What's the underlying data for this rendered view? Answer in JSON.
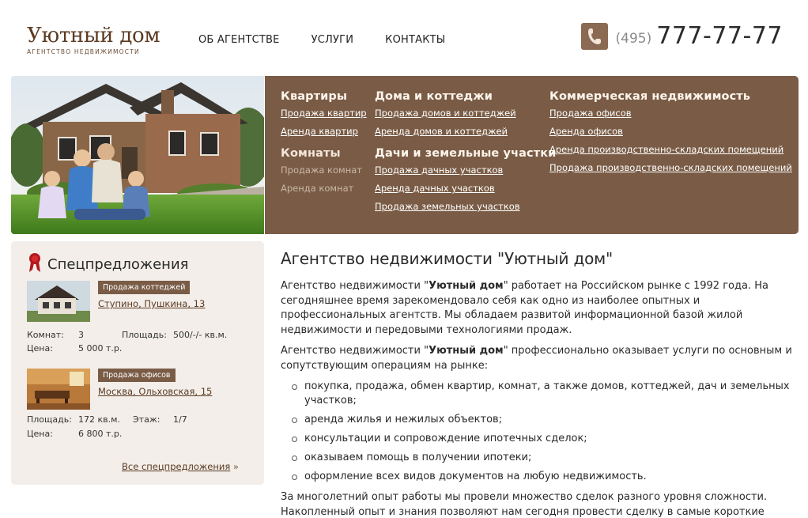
{
  "header": {
    "logo_title": "Уютный дом",
    "logo_subtitle": "АГЕНТСТВО НЕДВИЖИМОСТИ",
    "nav": [
      "ОБ АГЕНТСТВЕ",
      "УСЛУГИ",
      "КОНТАКТЫ"
    ],
    "phone_code": "(495)",
    "phone_number": "777-77-77",
    "phone_icon": "phone-icon"
  },
  "menu": {
    "col1": {
      "heading1": "Квартиры",
      "links1": [
        "Продажа квартир",
        "Аренда квартир"
      ],
      "heading2": "Комнаты",
      "links2": [
        "Продажа комнат",
        "Аренда комнат"
      ]
    },
    "col2": {
      "heading1": "Дома и коттеджи",
      "links1": [
        "Продажа домов и коттеджей",
        "Аренда домов и коттеджей"
      ],
      "heading2": "Дачи и земельные участки",
      "links2": [
        "Продажа дачных участков",
        "Аренда дачных участков",
        "Продажа земельных участков"
      ]
    },
    "col3": {
      "heading1": "Коммерческая недвижимость",
      "links1": [
        "Продажа офисов",
        "Аренда офисов",
        "Аренда производственно-складских помещений",
        "Продажа производственно-складских помещений"
      ]
    }
  },
  "sidebar": {
    "title": "Спецпредложения",
    "offers": [
      {
        "tag": "Продажа коттеджей",
        "address": "Ступино, Пушкина, 13",
        "rooms_label": "Комнат:",
        "rooms_value": "3",
        "area_label": "Площадь:",
        "area_value": "500/-/- кв.м.",
        "price_label": "Цена:",
        "price_value": "5 000 т.р."
      },
      {
        "tag": "Продажа офисов",
        "address": "Москва, Ольховская, 15",
        "area_label": "Площадь:",
        "area_value": "172 кв.м.",
        "floor_label": "Этаж:",
        "floor_value": "1/7",
        "price_label": "Цена:",
        "price_value": "6 800 т.р."
      }
    ],
    "all_link": "Все спецпредложения",
    "all_arrow": "»"
  },
  "content": {
    "title": "Агентство недвижимости \"Уютный дом\"",
    "p1_a": "Агентство недвижимости \"",
    "p1_b": "Уютный дом",
    "p1_c": "\" работает на Российском рынке с 1992 года. На сегодняшнее время зарекомендовало себя как одно из наиболее опытных и профессиональных агентств. Мы обладаем развитой информационной базой жилой недвижимости и передовыми технологиями продаж.",
    "p2_a": "Агентство недвижимости \"",
    "p2_b": "Уютный дом",
    "p2_c": "\" профессионально оказывает услуги по основным и сопутствующим операциям на рынке:",
    "list": [
      "покупка, продажа, обмен квартир, комнат, а также домов, коттеджей, дач и земельных участков;",
      "аренда жилья и нежилых объектов;",
      "консультации и сопровождение ипотечных сделок;",
      "оказываем помощь в получении ипотеки;",
      "оформление всех видов документов на любую недвижимость."
    ],
    "p3": "За многолетний опыт работы мы провели множество сделок разного уровня сложности. Накопленный опыт и знания позволяют нам сегодня провести сделку в самые короткие сроки."
  }
}
